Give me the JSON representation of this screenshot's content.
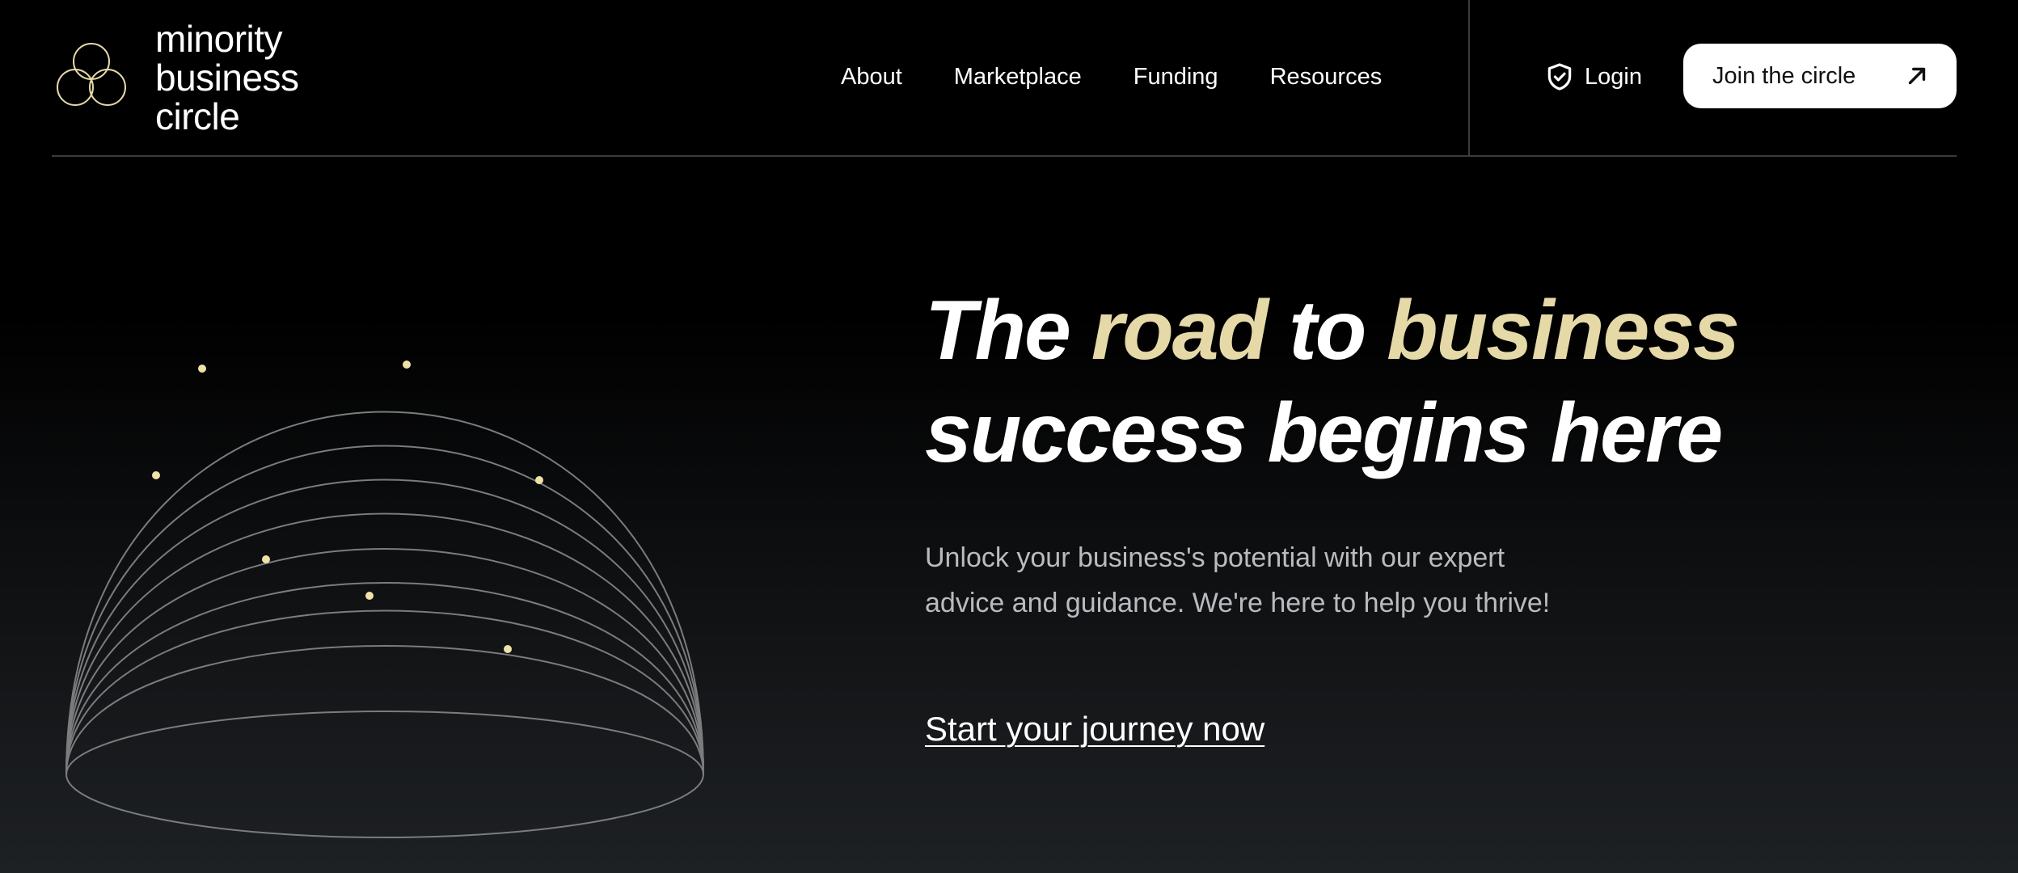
{
  "brand": {
    "name_lines": [
      "minority",
      "business",
      "circle"
    ],
    "logo_icon": "three-interlocking-circles-icon",
    "accent_color": "#e5d9a8"
  },
  "nav": {
    "items": [
      {
        "label": "About"
      },
      {
        "label": "Marketplace"
      },
      {
        "label": "Funding"
      },
      {
        "label": "Resources"
      }
    ]
  },
  "header_actions": {
    "login_label": "Login",
    "login_icon": "shield-check-icon",
    "join_label": "Join the circle",
    "join_icon": "arrow-up-right-icon"
  },
  "hero": {
    "headline": {
      "line1": [
        {
          "text": "The ",
          "accent": false
        },
        {
          "text": "road",
          "accent": true
        },
        {
          "text": " to ",
          "accent": false
        },
        {
          "text": "business",
          "accent": true
        }
      ],
      "line2": "success begins here"
    },
    "subcopy": "Unlock your business's potential with our expert advice and guidance. We're here to help you thrive!",
    "cta_label": "Start your journey now",
    "illustration_icon": "wireframe-dome-orbit-icon"
  },
  "colors": {
    "background_top": "#000000",
    "background_bottom": "#1e2124",
    "accent": "#e5d9a8",
    "subtext": "#b9bcbf",
    "divider": "#3a3b3d"
  }
}
